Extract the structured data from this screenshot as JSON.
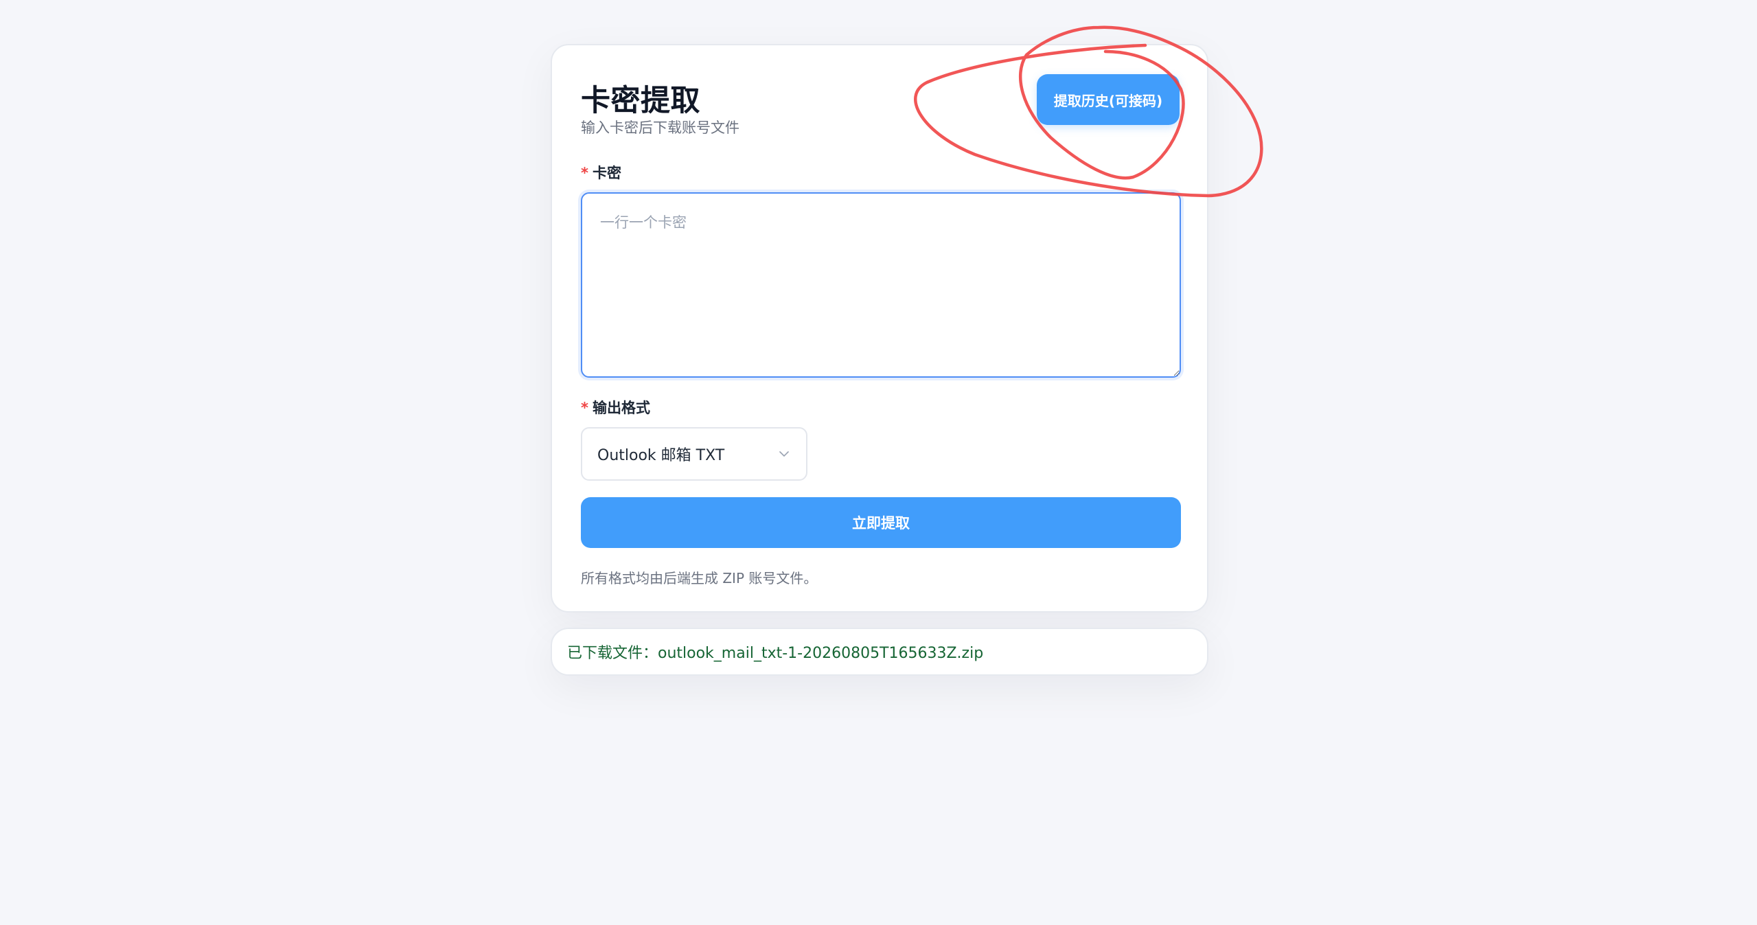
{
  "card": {
    "title": "卡密提取",
    "subtitle": "输入卡密后下载账号文件",
    "history_button": "提取历史(可接码)"
  },
  "form": {
    "required_mark": "*",
    "card_label": "卡密",
    "card_placeholder": "一行一个卡密",
    "format_label": "输出格式",
    "format_selected": "Outlook 邮箱 TXT",
    "submit_label": "立即提取",
    "hint": "所有格式均由后端生成 ZIP 账号文件。"
  },
  "result": {
    "message": "已下载文件：outlook_mail_txt-1-20260805T165633Z.zip"
  },
  "colors": {
    "accent": "#419dfb",
    "required": "#ef4444",
    "annotation": "#ef4444",
    "success_text": "#166534"
  },
  "icons": {
    "select_arrow": "chevron-down-icon"
  }
}
